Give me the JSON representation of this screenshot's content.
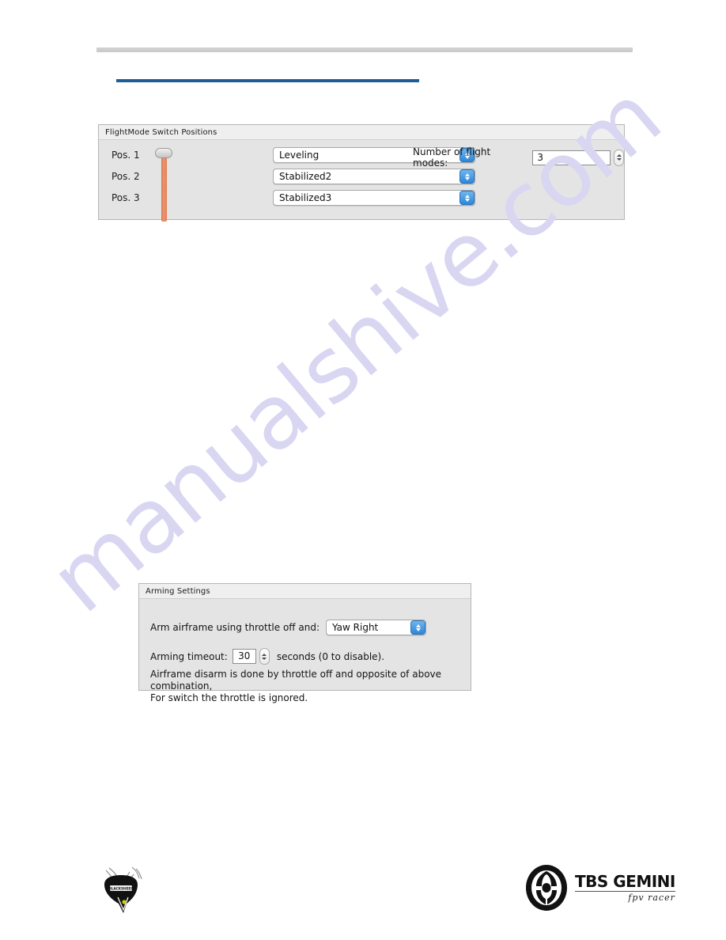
{
  "page": {
    "background": "#ffffff",
    "accent_color": "#1f5d96",
    "watermark_text": "manualshive.com",
    "watermark_color": "#d9d6f2"
  },
  "flightmode_panel": {
    "title": "FlightMode Switch Positions",
    "positions": [
      {
        "label": "Pos. 1",
        "value": "Leveling"
      },
      {
        "label": "Pos. 2",
        "value": "Stabilized2"
      },
      {
        "label": "Pos. 3",
        "value": "Stabilized3"
      }
    ],
    "num_modes_label": "Number of flight modes:",
    "num_modes_value": "3",
    "slider_track_color": "#e07f55"
  },
  "arming_panel": {
    "title": "Arming Settings",
    "arm_label": "Arm airframe using throttle off and:",
    "arm_value": "Yaw Right",
    "timeout_label": "Arming timeout:",
    "timeout_value": "30",
    "timeout_suffix": "seconds (0 to disable).",
    "note_line_1": "Airframe disarm is done by throttle off and opposite of above combination,",
    "note_line_2": "For switch the throttle is ignored."
  },
  "footer": {
    "tbs_name": "TBS GEMINI",
    "tbs_tagline": "fpv racer"
  }
}
